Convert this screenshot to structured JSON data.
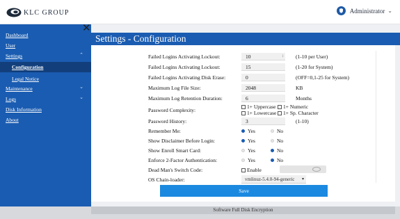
{
  "brand": {
    "name": "KLC GROUP"
  },
  "user": {
    "name": "Administrator"
  },
  "sidebar": {
    "items": [
      {
        "label": "Dashboard"
      },
      {
        "label": "User"
      },
      {
        "label": "Settings"
      },
      {
        "label": "Configuration"
      },
      {
        "label": "Legal Notice"
      },
      {
        "label": "Maintenance"
      },
      {
        "label": "Logs"
      },
      {
        "label": "Disk Information"
      },
      {
        "label": "About"
      }
    ]
  },
  "page": {
    "title": "Settings - Configuration"
  },
  "form": {
    "failed_logins_lockout": {
      "label": "Failed Logins Activating Lockout:",
      "value": "10",
      "hint": "(1-10 per User)"
    },
    "failed_logins_lockout_system": {
      "label": "Failed Logins Activating Lockout:",
      "value": "15",
      "hint": "(1-20 for System)"
    },
    "failed_logins_disk_erase": {
      "label": "Failed Logins Activating Disk Erase:",
      "value": "0",
      "hint": "(OFF=0,1-25 for System)"
    },
    "max_log_file_size": {
      "label": "Maximum Log File Size:",
      "value": "2048",
      "unit": "KB"
    },
    "max_log_retention": {
      "label": "Maximum Log Retention Duration:",
      "value": "6",
      "unit": "Months"
    },
    "password_complexity": {
      "label": "Password Complexity:",
      "options": [
        "1+ Uppercase",
        "1+ Numeric",
        "1+ Lowercase",
        "1+ Sp. Character"
      ]
    },
    "password_history": {
      "label": "Password History:",
      "value": "3",
      "hint": "(1-10)"
    },
    "remember_me": {
      "label": "Remember Me:",
      "yes": "Yes",
      "no": "No",
      "selected": "Yes"
    },
    "show_disclaimer": {
      "label": "Show Disclaimer Before Login:",
      "yes": "Yes",
      "no": "No",
      "selected": "Yes"
    },
    "show_enroll_smart_card": {
      "label": "Show Enroll Smart Card:",
      "yes": "Yes",
      "no": "No",
      "selected": "No"
    },
    "enforce_2fa": {
      "label": "Enforce 2-Factor Authentication:",
      "yes": "Yes",
      "no": "No",
      "selected": "No"
    },
    "dead_mans_switch": {
      "label": "Dead Man's Switch Code:",
      "enable": "Enable"
    },
    "os_chain_loader": {
      "label": "OS Chain-loader:",
      "value": "vmlinuz-5.4.0-94-generic"
    },
    "save": "Save"
  },
  "footer": {
    "text": "Software Full Disk Encryption"
  },
  "colors": {
    "primary": "#1a5cb1",
    "sidebar_active": "#123f7c",
    "save_button": "#1c89e0"
  },
  "icons": {
    "logo": "klc-logo-icon",
    "user": "shield-user-icon",
    "close": "close-icon",
    "eye": "eye-icon"
  }
}
